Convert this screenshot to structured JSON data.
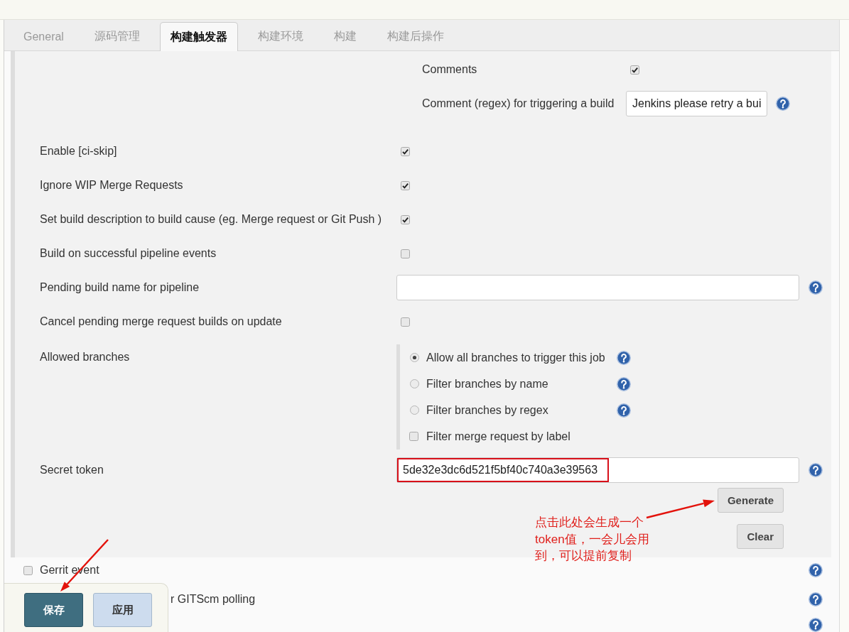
{
  "tabs": [
    {
      "label": "General",
      "selected": false
    },
    {
      "label": "源码管理",
      "selected": false
    },
    {
      "label": "构建触发器",
      "selected": true
    },
    {
      "label": "构建环境",
      "selected": false
    },
    {
      "label": "构建",
      "selected": false
    },
    {
      "label": "构建后操作",
      "selected": false
    }
  ],
  "comment_options": [
    {
      "kind": "checkbox",
      "label": "Comments",
      "checked": true,
      "help": false
    },
    {
      "kind": "text",
      "label": "Comment (regex) for triggering a build",
      "value": "Jenkins please retry a bui",
      "help": true
    }
  ],
  "options": [
    {
      "kind": "checkbox",
      "label": "Enable [ci-skip]",
      "checked": true,
      "help": false
    },
    {
      "kind": "checkbox",
      "label": "Ignore WIP Merge Requests",
      "checked": true,
      "help": false
    },
    {
      "kind": "checkbox",
      "label": "Set build description to build cause (eg. Merge request or Git Push )",
      "checked": true,
      "help": false
    },
    {
      "kind": "checkbox",
      "label": "Build on successful pipeline events",
      "checked": false,
      "help": false
    },
    {
      "kind": "text",
      "label": "Pending build name for pipeline",
      "help": true
    },
    {
      "kind": "checkbox",
      "label": "Cancel pending merge request builds on update",
      "checked": false,
      "help": false
    }
  ],
  "allowed_branches": {
    "label": "Allowed branches",
    "choices": [
      {
        "kind": "radio",
        "label": "Allow all branches to trigger this job",
        "selected": true,
        "help": true
      },
      {
        "kind": "radio",
        "label": "Filter branches by name",
        "selected": false,
        "help": true
      },
      {
        "kind": "radio",
        "label": "Filter branches by regex",
        "selected": false,
        "help": true
      },
      {
        "kind": "checkbox",
        "label": "Filter merge request by label",
        "checked": false,
        "help": false
      }
    ]
  },
  "secret_token": {
    "label": "Secret token",
    "value": "5de32e3dc6d521f5bf40c740a3e39563",
    "highlighted": true,
    "help": true,
    "buttons": [
      "Generate",
      "Clear"
    ]
  },
  "annotation": {
    "text": "点击此处会生成一个token值，一会儿会用到，可以提前复制"
  },
  "other_triggers": [
    {
      "label": "Gerrit event",
      "checked": false,
      "help": true
    },
    {
      "label": "r GITScm polling",
      "help": true
    },
    {
      "help": true
    }
  ],
  "save_bar": {
    "buttons": [
      {
        "label": "保存",
        "kind": "primary"
      },
      {
        "label": "应用",
        "kind": "secondary"
      }
    ]
  }
}
